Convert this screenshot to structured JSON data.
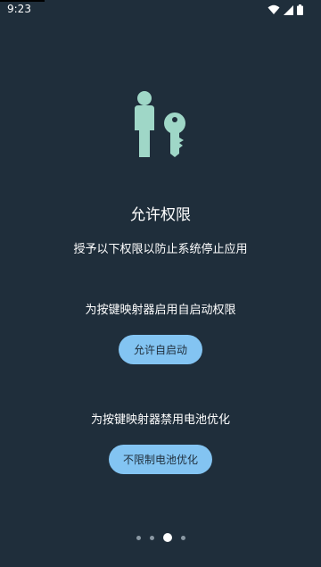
{
  "status_bar": {
    "time": "9:23"
  },
  "hero": {
    "icon": "person-with-key-icon",
    "icon_color": "#9fd7c7"
  },
  "title": "允许权限",
  "subtitle": "授予以下权限以防止系统停止应用",
  "sections": [
    {
      "description": "为按键映射器启用自启动权限",
      "button_label": "允许自启动"
    },
    {
      "description": "为按键映射器禁用电池优化",
      "button_label": "不限制电池优化"
    }
  ],
  "pager": {
    "total_pages": 4,
    "current_page": 3
  },
  "colors": {
    "background": "#1f2e3b",
    "accent": "#83c4f2"
  }
}
